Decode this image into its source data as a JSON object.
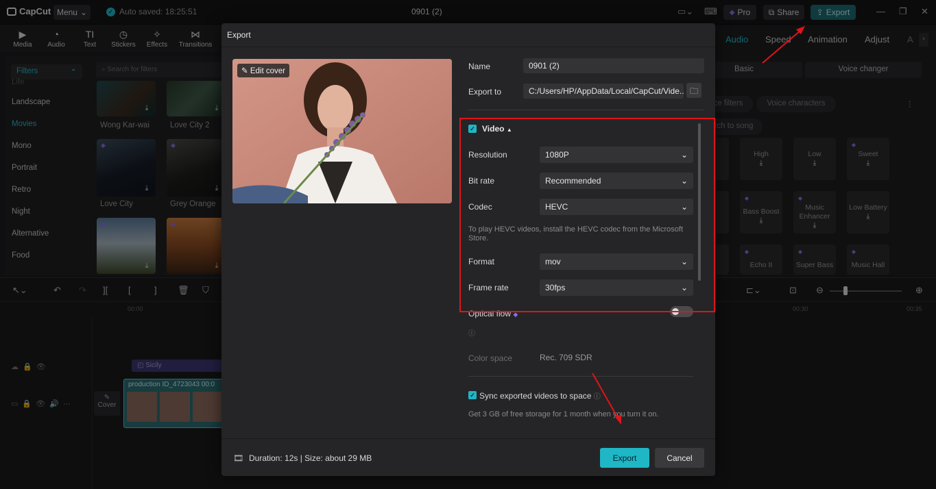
{
  "app": {
    "logo": "CapCut",
    "menu_label": "Menu",
    "autosave": "Auto saved: 18:25:51",
    "project_title": "0901 (2)",
    "pro_label": "Pro",
    "share_label": "Share",
    "export_label": "Export"
  },
  "toolbar": {
    "tools": [
      "Media",
      "Audio",
      "Text",
      "Stickers",
      "Effects",
      "Transitions"
    ]
  },
  "left_panel": {
    "filters_head": "Filters",
    "search_placeholder": "Search for filters",
    "categories": [
      "Life",
      "Landscape",
      "Movies",
      "Mono",
      "Portrait",
      "Retro",
      "Night",
      "Alternative",
      "Food"
    ],
    "active_category": "Movies",
    "thumbs": [
      "Wong Kar-wai",
      "Love City 2",
      "Love City",
      "Grey Orange"
    ]
  },
  "right_panel": {
    "tabs": [
      "Audio",
      "Speed",
      "Animation",
      "Adjust",
      "A"
    ],
    "segments": [
      "Basic",
      "Voice changer"
    ],
    "pills": [
      "Voice filters",
      "Voice characters",
      "Switch to song"
    ],
    "cards": [
      [
        "ce",
        "High",
        "Low",
        "Sweet"
      ],
      [
        "r b",
        "Bass Boost",
        "Music Enhancer",
        "Low Battery"
      ],
      [
        "",
        "Echo II",
        "Super Bass",
        "Music Hall"
      ]
    ]
  },
  "timeline": {
    "ruler_start": "00:00",
    "ruler_mid": "00:30",
    "ruler_end": "00:35",
    "text_clip": "Sicily",
    "video_clip": "production ID_4723043",
    "video_clip_time": "00:0",
    "cover_label": "Cover"
  },
  "export_dialog": {
    "title": "Export",
    "edit_cover": "Edit cover",
    "name_label": "Name",
    "name_value": "0901 (2)",
    "export_to_label": "Export to",
    "export_to_value": "C:/Users/HP/AppData/Local/CapCut/Vide...",
    "video_section": "Video",
    "resolution_label": "Resolution",
    "resolution_value": "1080P",
    "bitrate_label": "Bit rate",
    "bitrate_value": "Recommended",
    "codec_label": "Codec",
    "codec_value": "HEVC",
    "codec_note": "To play HEVC videos, install the HEVC codec from the Microsoft Store.",
    "format_label": "Format",
    "format_value": "mov",
    "framerate_label": "Frame rate",
    "framerate_value": "30fps",
    "optical_flow_label": "Optical flow",
    "color_space_label": "Color space",
    "color_space_value": "Rec. 709 SDR",
    "sync_label": "Sync exported videos to space",
    "sync_note": "Get 3 GB of free storage for 1 month when you turn it on.",
    "footer_info": "Duration: 12s | Size: about 29 MB",
    "export_button": "Export",
    "cancel_button": "Cancel"
  },
  "colors": {
    "accent": "#1fb6c6",
    "highlight": "#e0141a"
  }
}
